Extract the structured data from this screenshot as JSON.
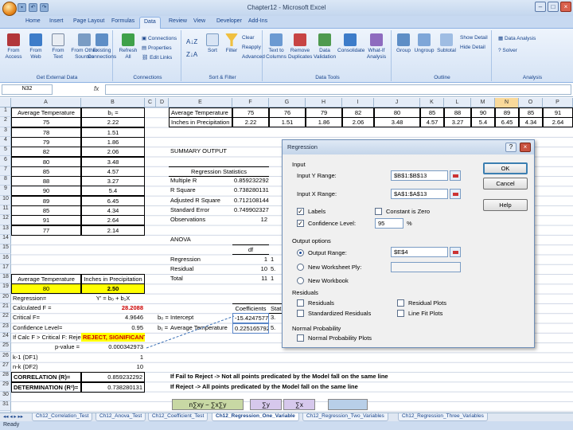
{
  "window": {
    "title": "Chapter12 - Microsoft Excel"
  },
  "tabs": [
    "Home",
    "Insert",
    "Page Layout",
    "Formulas",
    "Data",
    "Review",
    "View",
    "Developer",
    "Add-Ins"
  ],
  "ribbon": {
    "groups": [
      {
        "label": "Get External Data",
        "buttons": [
          "From Access",
          "From Web",
          "From Text",
          "From Other Sources"
        ]
      },
      {
        "label": "Connections",
        "buttons": [
          "Existing Connections",
          "Refresh All",
          "Connections",
          "Properties",
          "Edit Links"
        ]
      },
      {
        "label": "Sort & Filter",
        "buttons": [
          "Sort",
          "Filter",
          "Clear",
          "Reapply",
          "Advanced"
        ]
      },
      {
        "label": "Data Tools",
        "buttons": [
          "Text to Columns",
          "Remove Duplicates",
          "Data Validation",
          "Consolidate",
          "What-If Analysis"
        ]
      },
      {
        "label": "Outline",
        "buttons": [
          "Group",
          "Ungroup",
          "Subtotal",
          "Show Detail",
          "Hide Detail"
        ]
      },
      {
        "label": "Analysis",
        "buttons": [
          "Data Analysis",
          "Solver"
        ]
      }
    ]
  },
  "formula_bar": {
    "name_box": "N32",
    "fx": "fx",
    "content": ""
  },
  "columns": [
    "A",
    "B",
    "C",
    "D",
    "E",
    "F",
    "G",
    "H",
    "I",
    "J",
    "K",
    "L",
    "M",
    "N",
    "O",
    "P"
  ],
  "selected_column": "N",
  "rows": [
    "1",
    "2",
    "3",
    "4",
    "5",
    "6",
    "7",
    "8",
    "9",
    "10",
    "11",
    "12",
    "13",
    "14",
    "15",
    "16",
    "17",
    "18",
    "19",
    "20",
    "21",
    "22",
    "23",
    "24",
    "25",
    "26",
    "27",
    "28",
    "29",
    "30",
    "31"
  ],
  "sheet": {
    "a1": "Average Temperature",
    "b1": "b₁ =",
    "temps": [
      "75",
      "78",
      "79",
      "82",
      "80",
      "85",
      "88",
      "90",
      "89",
      "85",
      "91",
      "77"
    ],
    "precip": [
      "2.22",
      "1.51",
      "1.86",
      "2.06",
      "3.48",
      "4.57",
      "3.27",
      "5.4",
      "6.45",
      "4.34",
      "2.64",
      "2.14"
    ],
    "a16": "Average Temperature",
    "b16": "Inches in Precipitation",
    "a17": "80",
    "b17": "2.50",
    "a18": "Regression=",
    "b18": "Y' = b₀ + b₁X",
    "a19": "Calculated F =",
    "b19": "28.2088",
    "a20": "Critical F=",
    "b20": "4.9646",
    "a21": "Confidence Level=",
    "b21": "0.95",
    "a22": "If Calc F > Critical F: Reject",
    "b22": "REJECT, SIGNIFICANT",
    "a23": "p-value =",
    "b23": "0.000342973",
    "a24": "k-1 (DF1)",
    "b24": "1",
    "a25": "n-k (DF2)",
    "b25": "10",
    "a26": "CORRELATION (R)=",
    "b26": "0.859232292",
    "a27": "DETERMINATION (R²)=",
    "b27": "0.738280131",
    "e1": "Average Temperature",
    "e2": "Inches in Precipitation",
    "row1_values": [
      "75",
      "76",
      "79",
      "82",
      "80",
      "85",
      "88",
      "90",
      "89",
      "85",
      "91"
    ],
    "row2_values": [
      "2.22",
      "1.51",
      "1.86",
      "2.06",
      "3.48",
      "4.57",
      "3.27",
      "5.4",
      "6.45",
      "4.34",
      "2.64"
    ],
    "summary": "SUMMARY OUTPUT",
    "reg_stats": "Regression Statistics",
    "reg_labels": [
      "Multiple R",
      "R Square",
      "Adjusted R Square",
      "Standard Error",
      "Observations"
    ],
    "reg_values": [
      "0.859232292",
      "0.738280131",
      "0.712108144",
      "0.749902327",
      "12"
    ],
    "anova": "ANOVA",
    "anova_df": "df",
    "anova_labels": [
      "Regression",
      "Residual",
      "Total"
    ],
    "anova_dfs": [
      "1",
      "10",
      "11"
    ],
    "anova_ss": [
      "1",
      "5.",
      "1"
    ],
    "coef_hdr": "Coefficients",
    "stat_hdr": "Stat",
    "b0": "b₀ =",
    "intercept": "Intercept",
    "avgtemp": "Average Temperature",
    "coef1": "-15.42475773",
    "coef2": "0.225165792",
    "stat1": "3.",
    "stat2": "5.",
    "note1": "If Fail to Reject -> Not all points predicated by the Model fall on the same line",
    "note2": "If Reject -> All points predicated by the Model fall on the same line",
    "chips": [
      "n∑xy − ∑x∑y",
      "∑y",
      "∑x"
    ]
  },
  "dialog": {
    "title": "Regression",
    "help_glyph": "?",
    "close_glyph": "×",
    "input_section": "Input",
    "input_y_label": "Input Y Range:",
    "input_y_value": "$B$1:$B$13",
    "input_x_label": "Input X Range:",
    "input_x_value": "$A$1:$A$13",
    "labels": "Labels",
    "constant_zero": "Constant is Zero",
    "confidence": "Confidence Level:",
    "confidence_value": "95",
    "percent": "%",
    "output_section": "Output options",
    "output_range": "Output Range:",
    "output_range_value": "$E$4",
    "new_ply": "New Worksheet Ply:",
    "new_workbook": "New Workbook",
    "residuals_section": "Residuals",
    "residuals": "Residuals",
    "std_residuals": "Standardized Residuals",
    "residual_plots": "Residual Plots",
    "line_fit": "Line Fit Plots",
    "normal_section": "Normal Probability",
    "normal_plots": "Normal Probability Plots",
    "ok": "OK",
    "cancel": "Cancel",
    "help": "Help",
    "labels_checked": true,
    "confidence_checked": true
  },
  "sheet_tabs": [
    "Ch12_Correlation_Test",
    "Ch12_Anova_Test",
    "Ch12_Coefficient_Test",
    "Ch12_Regression_One_Variable",
    "Ch12_Regression_Two_Variables",
    "Ch12_Regression_Three_Variables"
  ],
  "status": "Ready"
}
